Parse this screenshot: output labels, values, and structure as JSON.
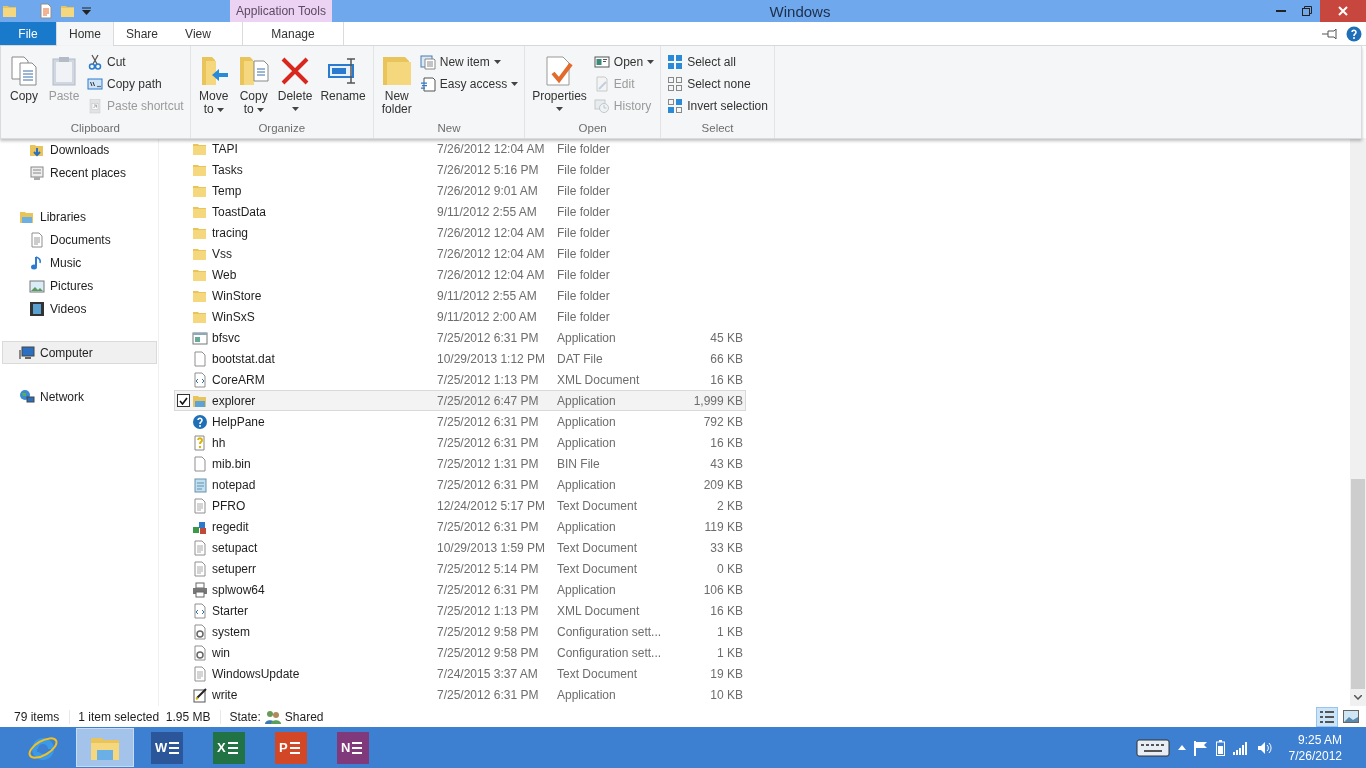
{
  "window": {
    "title": "Windows",
    "context_header": "Application Tools"
  },
  "tabs": [
    {
      "label": "File",
      "kind": "file",
      "selected": false
    },
    {
      "label": "Home",
      "kind": "tab",
      "selected": true
    },
    {
      "label": "Share",
      "kind": "tab",
      "selected": false
    },
    {
      "label": "View",
      "kind": "tab",
      "selected": false
    },
    {
      "label": "Manage",
      "kind": "context",
      "selected": false
    }
  ],
  "ribbon": {
    "groups": [
      {
        "label": "Clipboard",
        "items": [
          {
            "kind": "large",
            "label_lines": [
              "Copy"
            ],
            "dropdown": false,
            "disabled": false
          },
          {
            "kind": "large",
            "label_lines": [
              "Paste"
            ],
            "dropdown": false,
            "disabled": true
          },
          {
            "kind": "stack",
            "items": [
              {
                "label": "Cut",
                "disabled": false,
                "dropdown": false
              },
              {
                "label": "Copy path",
                "disabled": false,
                "dropdown": false
              },
              {
                "label": "Paste shortcut",
                "disabled": true,
                "dropdown": false
              }
            ]
          }
        ]
      },
      {
        "label": "Organize",
        "items": [
          {
            "kind": "large",
            "label_lines": [
              "Move",
              "to"
            ],
            "dropdown": true,
            "disabled": false
          },
          {
            "kind": "large",
            "label_lines": [
              "Copy",
              "to"
            ],
            "dropdown": true,
            "disabled": false
          },
          {
            "kind": "large",
            "label_lines": [
              "Delete"
            ],
            "dropdown": true,
            "disabled": false
          },
          {
            "kind": "large",
            "label_lines": [
              "Rename"
            ],
            "dropdown": false,
            "disabled": false
          }
        ]
      },
      {
        "label": "New",
        "items": [
          {
            "kind": "large",
            "label_lines": [
              "New",
              "folder"
            ],
            "dropdown": false,
            "disabled": false
          },
          {
            "kind": "stack",
            "items": [
              {
                "label": "New item",
                "disabled": false,
                "dropdown": true
              },
              {
                "label": "Easy access",
                "disabled": false,
                "dropdown": true
              }
            ]
          }
        ]
      },
      {
        "label": "Open",
        "items": [
          {
            "kind": "large",
            "label_lines": [
              "Properties"
            ],
            "dropdown": true,
            "disabled": false
          },
          {
            "kind": "stack",
            "items": [
              {
                "label": "Open",
                "disabled": false,
                "dropdown": true
              },
              {
                "label": "Edit",
                "disabled": true,
                "dropdown": false
              },
              {
                "label": "History",
                "disabled": true,
                "dropdown": false
              }
            ]
          }
        ]
      },
      {
        "label": "Select",
        "items": [
          {
            "kind": "stack",
            "items": [
              {
                "label": "Select all",
                "disabled": false,
                "dropdown": false
              },
              {
                "label": "Select none",
                "disabled": false,
                "dropdown": false
              },
              {
                "label": "Invert selection",
                "disabled": false,
                "dropdown": false
              }
            ]
          }
        ]
      }
    ]
  },
  "navigation": {
    "favorites_items": [
      {
        "label": "Downloads",
        "kind": "downloads",
        "selected": false
      },
      {
        "label": "Recent places",
        "kind": "recent",
        "selected": false
      }
    ],
    "tree": [
      {
        "label": "Libraries",
        "kind": "libraries",
        "selected": false,
        "children": [
          {
            "label": "Documents",
            "kind": "documents",
            "selected": false
          },
          {
            "label": "Music",
            "kind": "music",
            "selected": false
          },
          {
            "label": "Pictures",
            "kind": "pictures",
            "selected": false
          },
          {
            "label": "Videos",
            "kind": "videos",
            "selected": false
          }
        ]
      },
      {
        "label": "Computer",
        "kind": "computer",
        "selected": true
      },
      {
        "label": "Network",
        "kind": "network",
        "selected": false
      }
    ]
  },
  "files": [
    {
      "name": "TAPI",
      "date": "7/26/2012 12:04 AM",
      "type": "File folder",
      "kind": "folder",
      "selected": false
    },
    {
      "name": "Tasks",
      "date": "7/26/2012 5:16 PM",
      "type": "File folder",
      "kind": "folder",
      "selected": false
    },
    {
      "name": "Temp",
      "date": "7/26/2012 9:01 AM",
      "type": "File folder",
      "kind": "folder",
      "selected": false
    },
    {
      "name": "ToastData",
      "date": "9/11/2012 2:55 AM",
      "type": "File folder",
      "kind": "folder",
      "selected": false
    },
    {
      "name": "tracing",
      "date": "7/26/2012 12:04 AM",
      "type": "File folder",
      "kind": "folder",
      "selected": false
    },
    {
      "name": "Vss",
      "date": "7/26/2012 12:04 AM",
      "type": "File folder",
      "kind": "folder",
      "selected": false
    },
    {
      "name": "Web",
      "date": "7/26/2012 12:04 AM",
      "type": "File folder",
      "kind": "folder",
      "selected": false
    },
    {
      "name": "WinStore",
      "date": "9/11/2012 2:55 AM",
      "type": "File folder",
      "kind": "folder",
      "selected": false
    },
    {
      "name": "WinSxS",
      "date": "9/11/2012 2:00 AM",
      "type": "File folder",
      "kind": "folder",
      "selected": false
    },
    {
      "name": "bfsvc",
      "date": "7/25/2012 6:31 PM",
      "type": "Application",
      "size": "45 KB",
      "kind": "app",
      "selected": false
    },
    {
      "name": "bootstat.dat",
      "date": "10/29/2013 1:12 PM",
      "type": "DAT File",
      "size": "66 KB",
      "kind": "file",
      "selected": false
    },
    {
      "name": "CoreARM",
      "date": "7/25/2012 1:13 PM",
      "type": "XML Document",
      "size": "16 KB",
      "kind": "xml",
      "selected": false
    },
    {
      "name": "explorer",
      "date": "7/25/2012 6:47 PM",
      "type": "Application",
      "size": "1,999 KB",
      "kind": "explorer",
      "selected": true
    },
    {
      "name": "HelpPane",
      "date": "7/25/2012 6:31 PM",
      "type": "Application",
      "size": "792 KB",
      "kind": "help",
      "selected": false
    },
    {
      "name": "hh",
      "date": "7/25/2012 6:31 PM",
      "type": "Application",
      "size": "16 KB",
      "kind": "hh",
      "selected": false
    },
    {
      "name": "mib.bin",
      "date": "7/25/2012 1:31 PM",
      "type": "BIN File",
      "size": "43 KB",
      "kind": "file",
      "selected": false
    },
    {
      "name": "notepad",
      "date": "7/25/2012 6:31 PM",
      "type": "Application",
      "size": "209 KB",
      "kind": "notepad",
      "selected": false
    },
    {
      "name": "PFRO",
      "date": "12/24/2012 5:17 PM",
      "type": "Text Document",
      "size": "2 KB",
      "kind": "text",
      "selected": false
    },
    {
      "name": "regedit",
      "date": "7/25/2012 6:31 PM",
      "type": "Application",
      "size": "119 KB",
      "kind": "regedit",
      "selected": false
    },
    {
      "name": "setupact",
      "date": "10/29/2013 1:59 PM",
      "type": "Text Document",
      "size": "33 KB",
      "kind": "text",
      "selected": false
    },
    {
      "name": "setuperr",
      "date": "7/25/2012 5:14 PM",
      "type": "Text Document",
      "size": "0 KB",
      "kind": "text",
      "selected": false
    },
    {
      "name": "splwow64",
      "date": "7/25/2012 6:31 PM",
      "type": "Application",
      "size": "106 KB",
      "kind": "printer",
      "selected": false
    },
    {
      "name": "Starter",
      "date": "7/25/2012 1:13 PM",
      "type": "XML Document",
      "size": "16 KB",
      "kind": "xml",
      "selected": false
    },
    {
      "name": "system",
      "date": "7/25/2012 9:58 PM",
      "type": "Configuration sett...",
      "size": "1 KB",
      "kind": "config",
      "selected": false
    },
    {
      "name": "win",
      "date": "7/25/2012 9:58 PM",
      "type": "Configuration sett...",
      "size": "1 KB",
      "kind": "config",
      "selected": false
    },
    {
      "name": "WindowsUpdate",
      "date": "7/24/2015 3:37 AM",
      "type": "Text Document",
      "size": "19 KB",
      "kind": "text",
      "selected": false
    },
    {
      "name": "write",
      "date": "7/25/2012 6:31 PM",
      "type": "Application",
      "size": "10 KB",
      "kind": "write",
      "selected": false
    }
  ],
  "status_bar": {
    "count": "79 items",
    "selection": "1 item selected  1.95 MB",
    "state_label": "State:",
    "state_value": "Shared"
  },
  "view_buttons": [
    {
      "kind": "details",
      "selected": true
    },
    {
      "kind": "large_icons",
      "selected": false
    }
  ],
  "taskbar": {
    "apps": [
      {
        "kind": "ie",
        "selected": false
      },
      {
        "kind": "explorer",
        "selected": true
      },
      {
        "kind": "office",
        "letter": "W",
        "color": "#2b579a",
        "selected": false
      },
      {
        "kind": "office",
        "letter": "X",
        "color": "#217346",
        "selected": false
      },
      {
        "kind": "office",
        "letter": "P",
        "color": "#d24726",
        "selected": false
      },
      {
        "kind": "office",
        "letter": "N",
        "color": "#80397b",
        "selected": false
      }
    ],
    "time": "9:25 AM",
    "date": "7/26/2012"
  }
}
